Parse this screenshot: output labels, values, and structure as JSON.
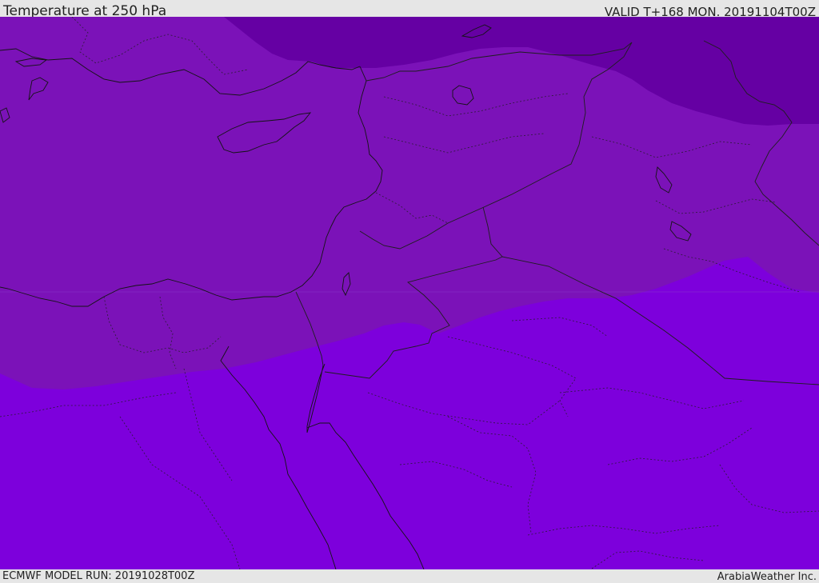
{
  "header": {
    "title": "Temperature at 250 hPa",
    "valid": "VALID T+168 MON. 20191104T00Z"
  },
  "footer": {
    "model_run": "ECMWF MODEL RUN: 20191028T00Z",
    "credit": "ArabiaWeather Inc."
  },
  "map": {
    "fill_colors": {
      "north_band": "#6500a3",
      "central_band": "#7b12b8",
      "south_band": "#7d00dc"
    },
    "coastline_color": "#141414",
    "border_color": "#1e1e1e"
  }
}
